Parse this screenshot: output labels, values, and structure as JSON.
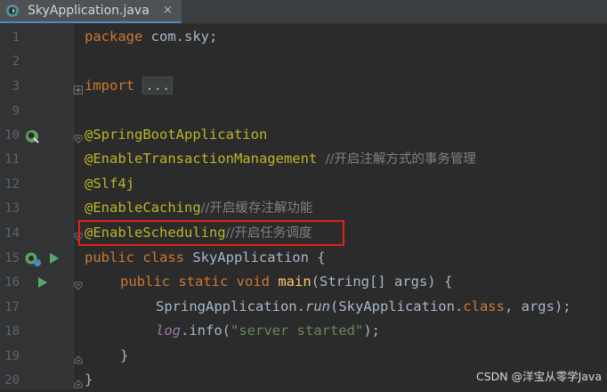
{
  "tab": {
    "title": "SkyApplication.java",
    "close": "×",
    "icon": "spring-java-class-icon"
  },
  "lines": {
    "n1": "1",
    "n2": "2",
    "n3": "3",
    "n9": "9",
    "n10": "10",
    "n11": "11",
    "n12": "12",
    "n13": "13",
    "n14": "14",
    "n15": "15",
    "n16": "16",
    "n17": "17",
    "n18": "18",
    "n19": "19",
    "n20": "20"
  },
  "code": {
    "l1_kw": "package",
    "l1_rest": " com.sky;",
    "l3_kw": "import",
    "l3_collapsed": "...",
    "l10_ann": "@SpringBootApplication",
    "l11_ann": "@EnableTransactionManagement",
    "l11_cmt": "//开启注解方式的事务管理",
    "l12_ann": "@Slf4j",
    "l13_ann": "@EnableCaching",
    "l13_cmt": "//开启缓存注解功能",
    "l14_ann": "@EnableScheduling",
    "l14_cmt": "//开启任务调度",
    "l15_kw": "public class",
    "l15_rest": " SkyApplication {",
    "l16_kw": "public static void",
    "l16_fn": "main",
    "l16_rest": "(String[] args) {",
    "l17_a": "SpringApplication.",
    "l17_run": "run",
    "l17_b": "(SkyApplication.",
    "l17_kw": "class",
    "l17_c": ", args);",
    "l18_log": "log",
    "l18_a": ".info(",
    "l18_str": "\"server started\"",
    "l18_b": ");",
    "l19": "}",
    "l20": "}"
  },
  "gutter_icons": [
    "spring-boot-icon",
    "run-icon"
  ],
  "watermark": "CSDN @洋宝从零学Java",
  "colors": {
    "background": "#2b2b2b",
    "annotation": "#bbb529",
    "keyword": "#cc7832",
    "string": "#6a8759",
    "comment": "#808080",
    "method": "#ffc66d",
    "highlight_box": "#e3201b"
  }
}
